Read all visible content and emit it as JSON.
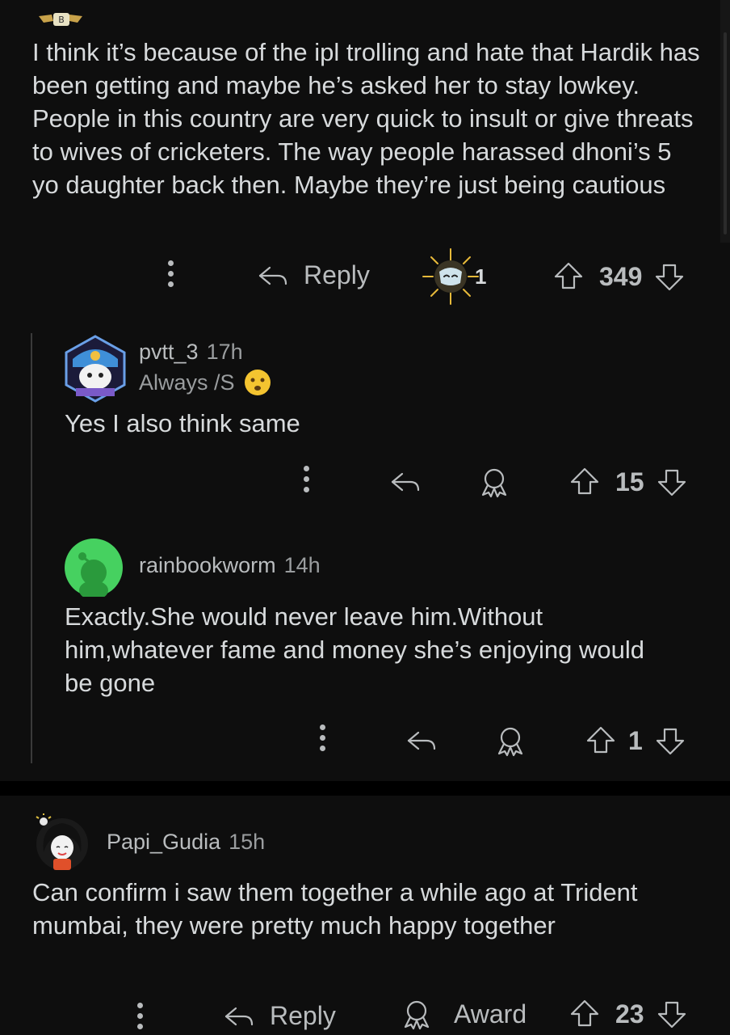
{
  "comment_top": {
    "text": "I think it’s because of the ipl trolling and hate that Hardik has been getting and maybe he’s asked her to stay lowkey. People in this country are very quick to insult or give threats to wives of cricketers. The way people harassed dhoni’s 5 yo daughter back then. Maybe they’re just being cautious",
    "reply_label": "Reply",
    "award_count": "1",
    "score": "349"
  },
  "reply1": {
    "username": "pvtt_3",
    "time": "17h",
    "flair": "Always /S",
    "text": "Yes I also think same",
    "score": "15"
  },
  "reply2": {
    "username": "rainbookworm",
    "time": "14h",
    "text": "Exactly.She would never leave him.Without him,whatever fame and money she’s enjoying would be gone",
    "score": "1"
  },
  "comment_bottom": {
    "username": "Papi_Gudia",
    "time": "15h",
    "text": "Can confirm i saw them together a while ago at Trident mumbai, they were pretty much happy together",
    "reply_label": "Reply",
    "award_label": "Award",
    "score": "23"
  },
  "colors": {
    "background": "#0e0e0e",
    "text": "#d7dadc",
    "muted": "#b9bcbe",
    "avatar_green": "#46d160"
  }
}
